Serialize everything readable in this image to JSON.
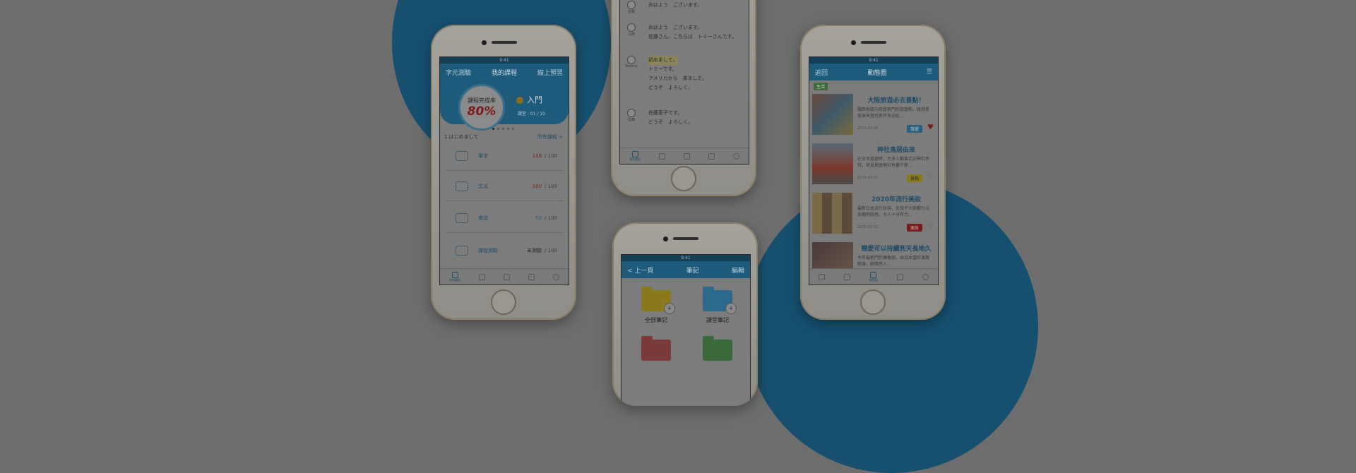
{
  "colors": {
    "background": "#6e6e6e",
    "accent_circle": "#17506f",
    "nav": "#1e5b7a",
    "highlight": "#7a1a1a"
  },
  "phone1": {
    "header": {
      "left": "字元測驗",
      "center": "我的課程",
      "right": "線上預習"
    },
    "completion_label": "課程完成率",
    "completion_value": "80%",
    "level_label": "入門",
    "progress_label": "課堂 : 01 / 10",
    "lesson_title": "1.はじめまして",
    "all_lessons": "所有課程 >",
    "rows": [
      {
        "label": "單字",
        "score": "100",
        "sep": "/",
        "total": "100"
      },
      {
        "label": "文法",
        "score": "100",
        "sep": "/",
        "total": "100"
      },
      {
        "label": "會話",
        "score": "59",
        "sep": "/",
        "total": "100"
      },
      {
        "label": "課程測驗",
        "score": "未測驗",
        "sep": "/",
        "total": "100"
      }
    ],
    "tabs": [
      "我的課程",
      "",
      "",
      "",
      ""
    ]
  },
  "phone2": {
    "messages": [
      {
        "name": "佐藤",
        "lines": [
          "おはよう　ございます。"
        ]
      },
      {
        "name": "山田",
        "lines": [
          "おはよう　ございます。",
          "佐藤さん、こちらは　トミーさんです。"
        ]
      },
      {
        "name": "Tommy",
        "lines": [
          "初めまして。",
          "トミーです。",
          "アメリカから　来ました。",
          "どうぞ　よろしく。"
        ]
      },
      {
        "name": "佐藤",
        "lines": [
          "佐藤恵子です。",
          "どうぞ　よろしく。"
        ]
      }
    ],
    "tabs": [
      "我的課程",
      "",
      "",
      "",
      ""
    ]
  },
  "phone3": {
    "header": {
      "left": "< 上一頁",
      "center": "筆記",
      "right": "編輯"
    },
    "folders": [
      {
        "label": "全部筆記",
        "count": "4"
      },
      {
        "label": "課堂筆記",
        "count": "4"
      }
    ]
  },
  "phone4": {
    "header": {
      "left": "返回",
      "center": "動態圈"
    },
    "tag": "生活",
    "articles": [
      {
        "title": "大阪旅遊必去景點！",
        "body": "關西地區向來是熱門的旅遊點，既然是美食天堂也有許多必吃…",
        "date": "2020-03-18",
        "category": "旅遊",
        "liked": true
      },
      {
        "title": "神社鳥居由來",
        "body": "在日本旅遊時，大多人都曾走訪神社參拜，常見鳥居神社有著什麼…",
        "date": "2020-03-12",
        "category": "景點",
        "liked": false
      },
      {
        "title": "2020年流行美妝",
        "body": "最新日本流行妝容，女孩子大家都引以為傲的妝感，令人十分有力…",
        "date": "2020-03-12",
        "category": "美妝",
        "liked": false
      },
      {
        "title": "戀愛可以持續到天長地久",
        "body": "今年最熱門的偶像劇，由日本當紅演員飾演，劇情感人…",
        "date": "",
        "category": "",
        "liked": false
      }
    ],
    "tabs": [
      "",
      "",
      "動態圈",
      "",
      ""
    ]
  }
}
